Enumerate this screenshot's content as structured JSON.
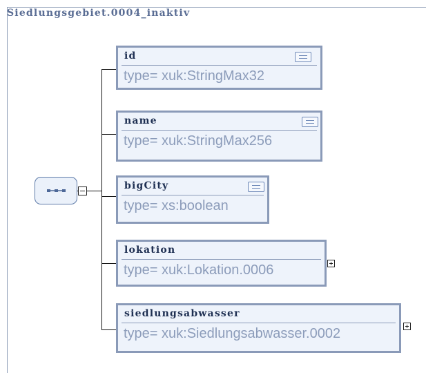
{
  "complex_type": {
    "name": "Siedlungsgebiet.0004_inaktiv"
  },
  "compositor": {
    "kind": "sequence",
    "icon": "sequence-icon"
  },
  "elements": [
    {
      "name": "id",
      "type": "type= xuk:StringMax32",
      "has_documentation": true,
      "expandable": false
    },
    {
      "name": "name",
      "type": "type= xuk:StringMax256",
      "has_documentation": true,
      "expandable": false
    },
    {
      "name": "bigCity",
      "type": "type= xs:boolean",
      "has_documentation": true,
      "expandable": false
    },
    {
      "name": "lokation",
      "type": "type= xuk:Lokation.0006",
      "has_documentation": false,
      "expandable": true
    },
    {
      "name": "siedlungsabwasser",
      "type": "type= xuk:Siedlungsabwasser.0002",
      "has_documentation": false,
      "expandable": true
    }
  ],
  "colors": {
    "frame_border": "#8f9fb8",
    "title_text": "#5a6d94",
    "element_border": "#8a9ab8",
    "element_fill": "#eef3fb",
    "element_name_text": "#1e2f52",
    "type_text": "#8c9cba",
    "compositor_border": "#5d7aa8",
    "compositor_fill": "#ebf1fa"
  }
}
